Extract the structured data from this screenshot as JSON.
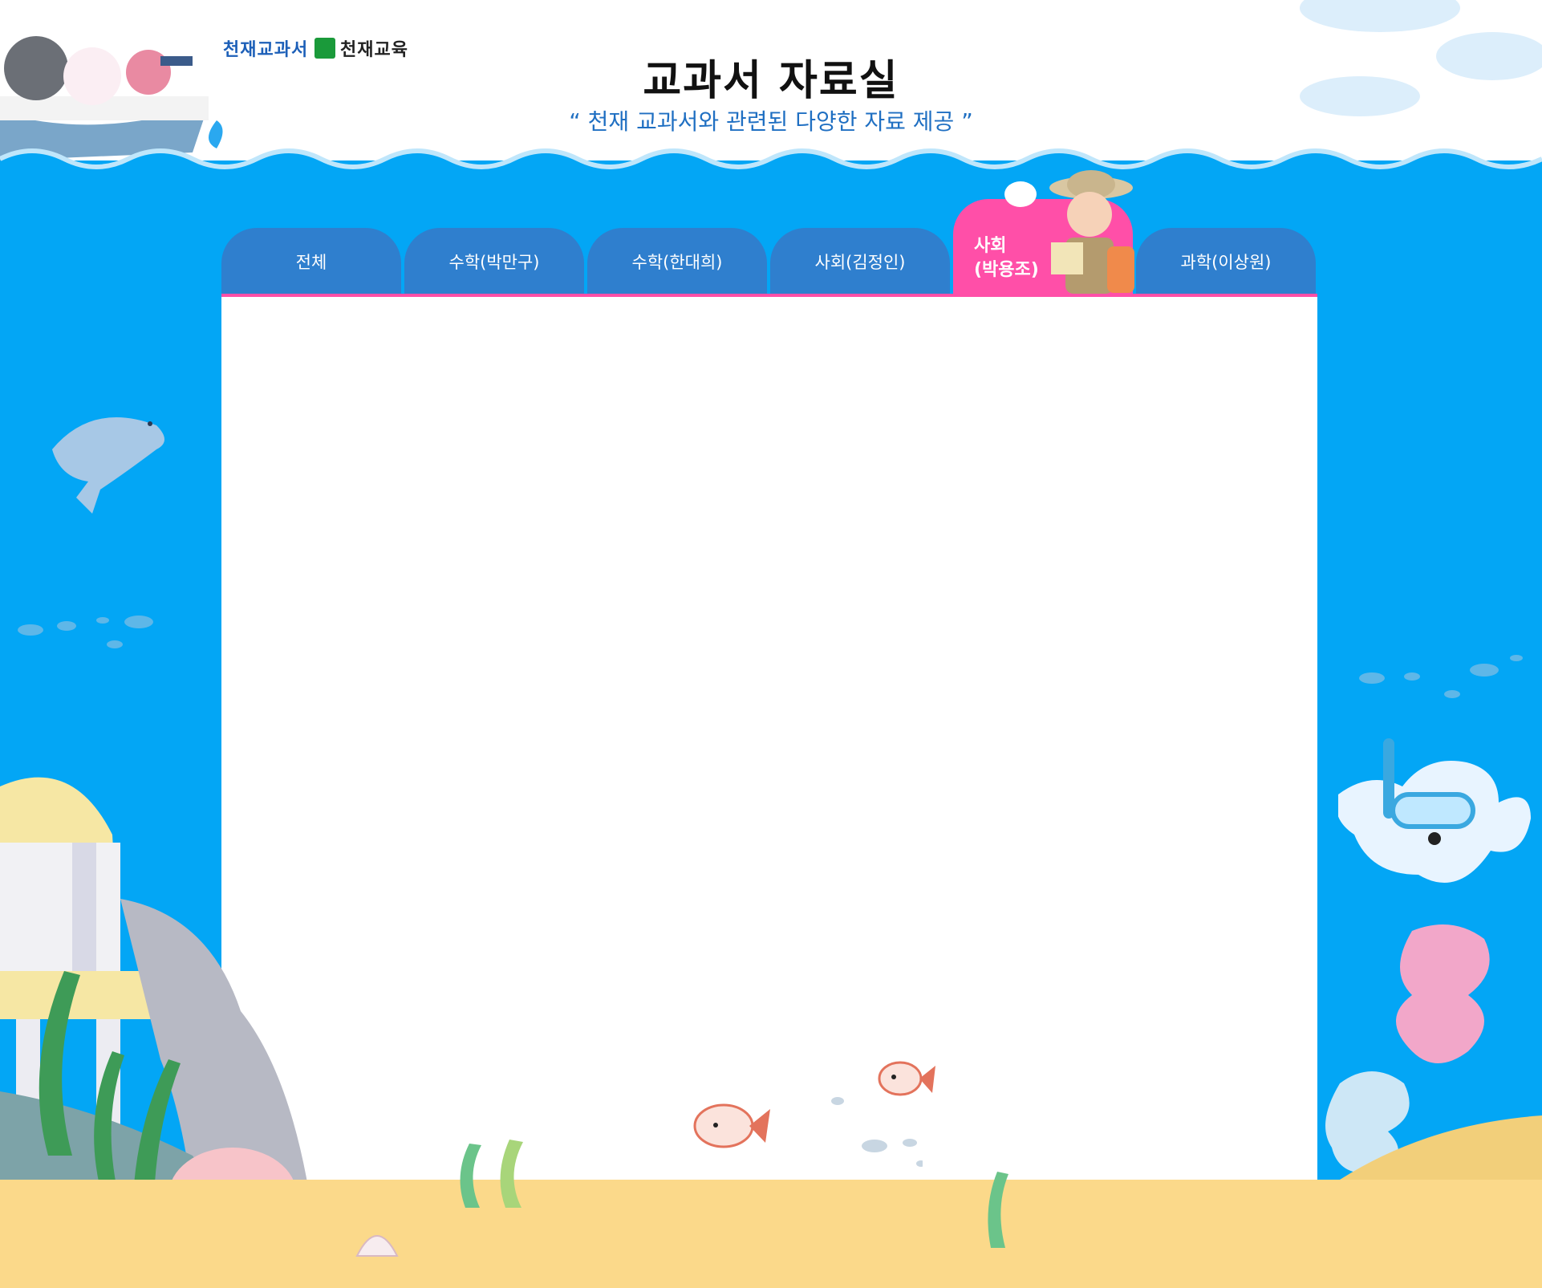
{
  "header": {
    "brand_primary": "천재교과서",
    "brand_secondary": "천재교육",
    "title": "교과서 자료실",
    "subtitle": "“ 천재 교과서와 관련된 다양한 자료 제공 ”"
  },
  "tabs": [
    {
      "label": "전체",
      "active": false
    },
    {
      "label": "수학(박만구)",
      "active": false
    },
    {
      "label": "수학(한대희)",
      "active": false
    },
    {
      "label": "사회(김정인)",
      "active": false
    },
    {
      "label": "사회\n(박용조)",
      "active": true
    },
    {
      "label": "과학(이상원)",
      "active": false
    }
  ],
  "colors": {
    "sea": "#03a6f5",
    "tab": "#2f7fce",
    "tab_active": "#ff4fa8",
    "title": "#111111",
    "subtitle": "#1f6fc2"
  },
  "icons": [
    "boat-with-characters-icon",
    "dolphin-icon",
    "polar-bear-snorkel-icon",
    "fish-icon",
    "explorer-girl-icon",
    "seaweed-icon",
    "pearl-shell-icon",
    "coral-icon"
  ]
}
